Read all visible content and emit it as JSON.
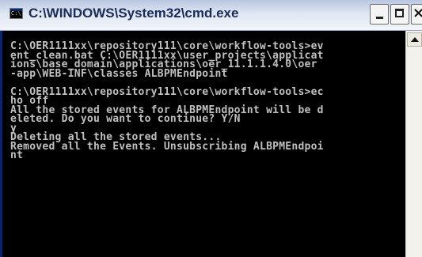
{
  "window": {
    "title": "C:\\WINDOWS\\System32\\cmd.exe",
    "icon": "console-window-icon",
    "icon_glyph": "C:\\",
    "close_glyph": "×"
  },
  "console": {
    "lines": [
      "C:\\OER1111xx\\repository111\\core\\workflow-tools>ev",
      "ent_clean.bat C:\\OER1111xx\\user_projects\\applicat",
      "ions\\base_domain\\applications\\oer_11.1.1.4.0\\oer",
      "-app\\WEB-INF\\classes ALBPMEndpoint",
      "",
      "C:\\OER1111xx\\repository111\\core\\workflow-tools>ec",
      "ho off",
      "All the stored events for ALBPMEndpoint will be d",
      "eleted. Do you want to continue? Y/N",
      "y",
      "Deleting all the stored events...",
      "Removed all the Events. Unsubscribing ALBPMEndpoi",
      "nt"
    ]
  },
  "colors": {
    "console_background": "#000000",
    "console_text": "#c0c0c0",
    "window_frame": "#0a246a",
    "titlebar": "#dfe7f3"
  }
}
